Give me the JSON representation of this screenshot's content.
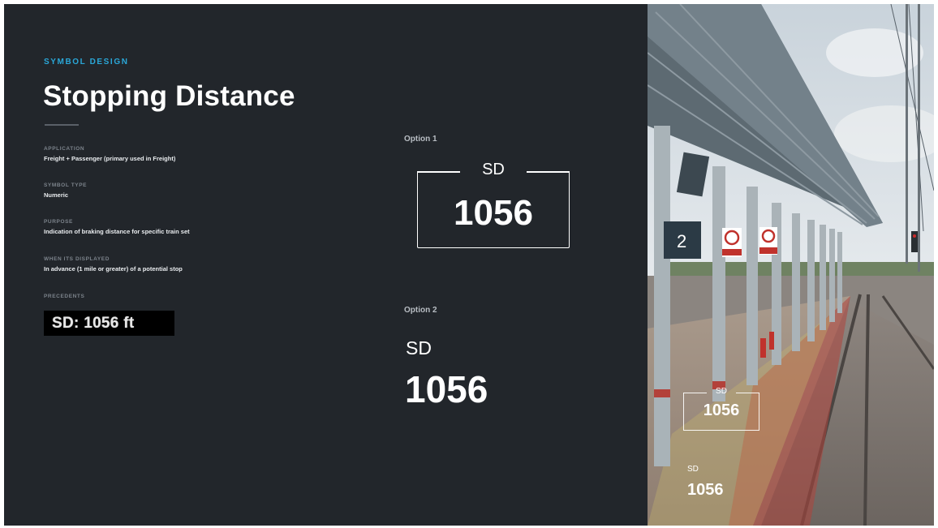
{
  "header": {
    "eyebrow": "SYMBOL DESIGN",
    "title": "Stopping Distance"
  },
  "meta": [
    {
      "label": "APPLICATION",
      "value": "Freight + Passenger (primary used in Freight)"
    },
    {
      "label": "SYMBOL TYPE",
      "value": "Numeric"
    },
    {
      "label": "PURPOSE",
      "value": "Indication of braking distance for specific train set"
    },
    {
      "label": "WHEN ITS DISPLAYED",
      "value": "In advance (1 mile or greater) of a potential stop"
    }
  ],
  "precedents": {
    "label": "PRECEDENTS",
    "example": "SD: 1056 ft"
  },
  "options": [
    {
      "label": "Option 1",
      "abbr": "SD",
      "value": "1056"
    },
    {
      "label": "Option 2",
      "abbr": "SD",
      "value": "1056"
    }
  ],
  "photo": {
    "platform_number": "2",
    "overlay1": {
      "abbr": "SD",
      "value": "1056"
    },
    "overlay2": {
      "abbr": "SD",
      "value": "1056"
    }
  },
  "colors": {
    "background": "#22262b",
    "accent": "#2aa7d8",
    "text": "#ffffff"
  }
}
